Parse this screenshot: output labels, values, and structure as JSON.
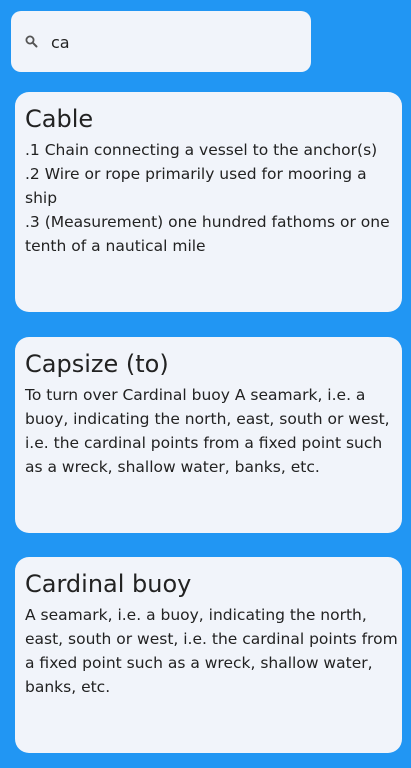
{
  "search": {
    "value": "ca",
    "icon": "search-icon"
  },
  "results": [
    {
      "term": "Cable",
      "definition": ".1 Chain connecting a vessel to the anchor(s)\n.2 Wire or rope primarily used for mooring a ship\n.3 (Measurement) one hundred fathoms or one tenth of a nautical mile"
    },
    {
      "term": "Capsize (to)",
      "definition": "To turn over Cardinal buoy A seamark, i.e. a buoy, indicating the north, east, south or west, i.e. the cardinal points from a fixed point such as a wreck, shallow water, banks, etc."
    },
    {
      "term": "Cardinal buoy",
      "definition": "A seamark, i.e. a buoy, indicating the north, east, south or west, i.e. the cardinal points from a fixed point such as a wreck, shallow water, banks, etc."
    }
  ],
  "colors": {
    "background": "#2196F3",
    "card": "#F1F4FA",
    "text": "#222222"
  }
}
